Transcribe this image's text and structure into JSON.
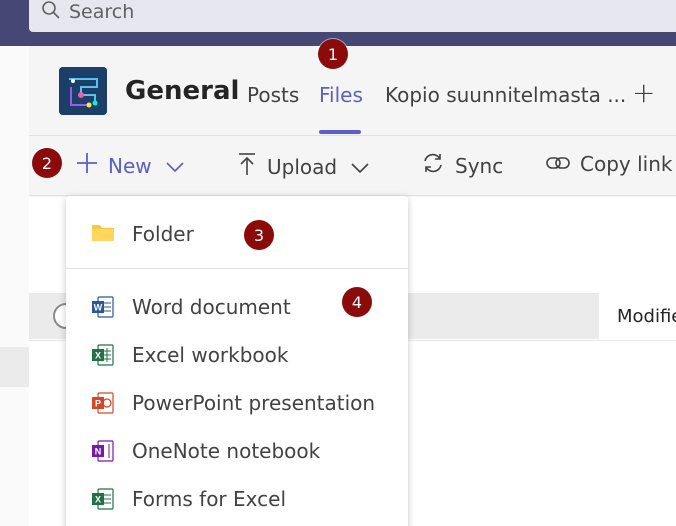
{
  "search": {
    "placeholder": "Search"
  },
  "channel": {
    "name": "General",
    "tabs": [
      {
        "label": "Posts"
      },
      {
        "label": "Files"
      },
      {
        "label": "Kopio suunnitelmasta ..."
      }
    ],
    "add_tab": "+"
  },
  "toolbar": {
    "new_label": "New",
    "upload_label": "Upload",
    "sync_label": "Sync",
    "copy_link_label": "Copy link"
  },
  "list": {
    "col_modified": "Modifie"
  },
  "menu": {
    "items": [
      {
        "label": "Folder"
      },
      {
        "label": "Word document"
      },
      {
        "label": "Excel workbook"
      },
      {
        "label": "PowerPoint presentation"
      },
      {
        "label": "OneNote notebook"
      },
      {
        "label": "Forms for Excel"
      }
    ]
  },
  "callouts": [
    "1",
    "2",
    "3",
    "4"
  ],
  "colors": {
    "accent": "#5b5fc7",
    "topbar": "#464775",
    "callout": "#8b0a0a",
    "word": "#2b579a",
    "excel": "#217346",
    "powerpoint": "#d24726",
    "onenote": "#7719aa",
    "folder": "#f8c93e"
  }
}
